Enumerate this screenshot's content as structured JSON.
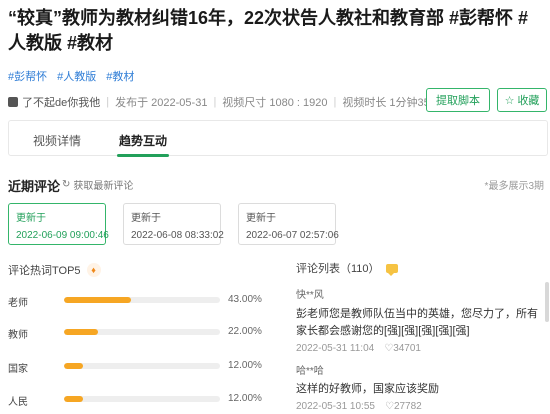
{
  "video": {
    "title": "“较真”教师为教材纠错16年，22次状告人教社和教育部 #彭帮怀 #人教版 #教材",
    "tags": [
      "#彭帮怀",
      "#人教版",
      "#教材"
    ],
    "author": "了不起de你我他",
    "publish_date": "发布于 2022-05-31",
    "video_size": "视频尺寸 1080 : 1920",
    "duration": "视频时长 1分钟35秒"
  },
  "actions": {
    "script_label": "提取脚本",
    "favorite_label": "收藏"
  },
  "tabs": [
    {
      "label": "视频详情"
    },
    {
      "label": "趋势互动"
    }
  ],
  "recent": {
    "title": "近期评论",
    "refresh_label": "获取最新评论",
    "max_note": "*最多展示3期",
    "updates": [
      {
        "label": "更新于",
        "date": "2022-06-09 09:00:46"
      },
      {
        "label": "更新于",
        "date": "2022-06-08 08:33:02"
      },
      {
        "label": "更新于",
        "date": "2022-06-07 02:57:06"
      }
    ]
  },
  "hot_words": {
    "title": "评论热词TOP5",
    "items": [
      {
        "word": "老师",
        "pct": "43.00%",
        "value": 43
      },
      {
        "word": "教师",
        "pct": "22.00%",
        "value": 22
      },
      {
        "word": "国家",
        "pct": "12.00%",
        "value": 12
      },
      {
        "word": "人民",
        "pct": "12.00%",
        "value": 12
      }
    ]
  },
  "comments": {
    "title": "评论列表（110）",
    "items": [
      {
        "user": "快**风",
        "text": "彭老师您是教师队伍当中的英雄，您尽力了，所有家长都会感谢您的[强][强][强][强][强]",
        "date": "2022-05-31 11:04",
        "likes": "34701"
      },
      {
        "user": "哈**哈",
        "text": "这样的好教师，国家应该奖励",
        "date": "2022-05-31 10:55",
        "likes": "27782"
      }
    ]
  },
  "colors": {
    "accent": "#22a05a",
    "bar": "#f6a623",
    "link": "#2f7dd6"
  }
}
